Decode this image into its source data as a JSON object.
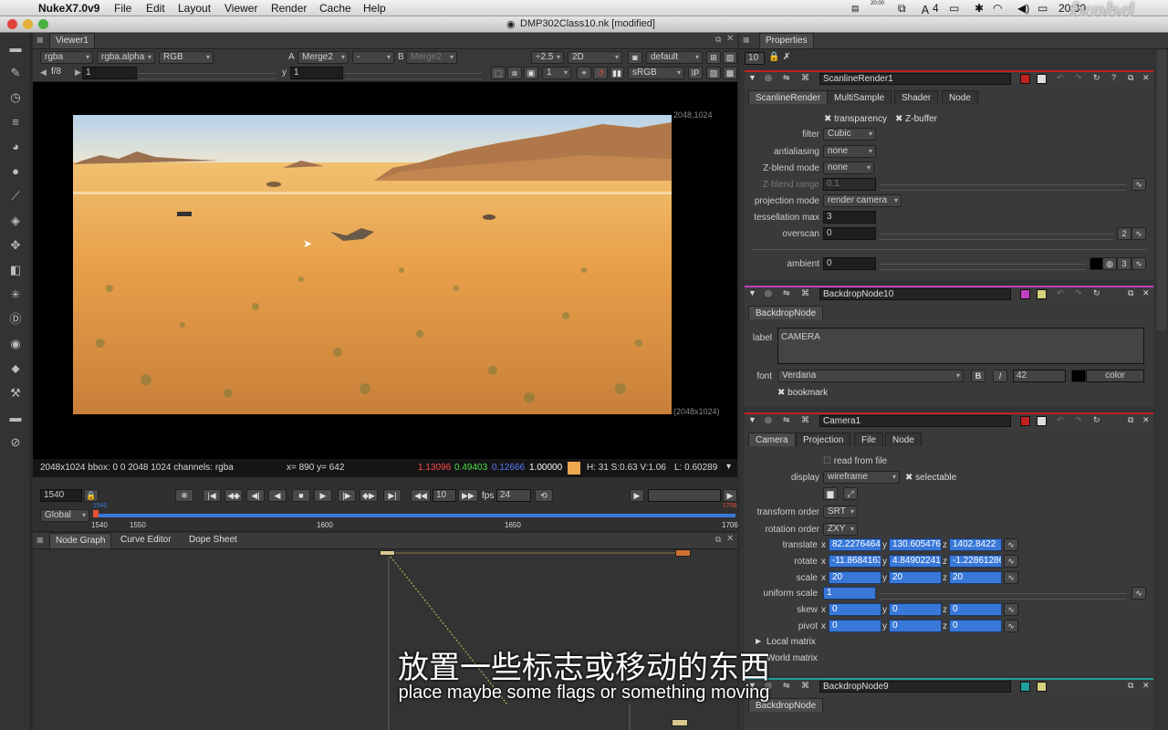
{
  "menubar": {
    "app": "NukeX7.0v9",
    "items": [
      "File",
      "Edit",
      "Layout",
      "Viewer",
      "Render",
      "Cache",
      "Help"
    ],
    "status": {
      "clock": "20:30",
      "badge": "4",
      "mini_time": "20:00"
    },
    "watermark": "fxphd"
  },
  "window": {
    "title": "DMP302Class10.nk [modified]"
  },
  "toolbar": {
    "icons": [
      "viewer-icon",
      "paint-icon",
      "time-icon",
      "channel-icon",
      "color-icon",
      "filter-icon",
      "keyer-icon",
      "merge-icon",
      "transform-icon",
      "3d-icon",
      "particles-icon",
      "deep-icon",
      "views-icon",
      "metadata-icon",
      "toolsets-icon",
      "other-icon",
      "furnace-icon"
    ]
  },
  "viewer": {
    "tab": "Viewer1",
    "row1": {
      "channels": "rgba",
      "alpha": "rgba.alpha",
      "display": "RGB",
      "a_label": "A",
      "a_input": "Merge2",
      "mid": "-",
      "b_label": "B",
      "b_input": "Merge2",
      "gain": "÷2.5",
      "mode": "2D",
      "lut": "default"
    },
    "row2": {
      "fstop": "f/8",
      "frame": "1",
      "y_label": "y",
      "y_value": "1",
      "proxy": "1",
      "colorspace": "sRGB",
      "ip": "IP"
    },
    "corner_tr": "2048,1024",
    "corner_br": "(2048x1024)",
    "info": {
      "format": "2048x1024 bbox: 0 0 2048 1024 channels: rgba",
      "coords": "x= 890 y= 642",
      "r": "1.13096",
      "g": "0.49403",
      "b": "0.12666",
      "a": "1.00000",
      "hsv": "H: 31 S:0.63 V:1.06",
      "lum": "L: 0.60289",
      "swatch": "#f0a850"
    }
  },
  "timeline": {
    "frame": "1540",
    "step": "10",
    "fps_label": "fps",
    "fps": "24",
    "range_mode": "Global",
    "start": "1540",
    "end": "1706",
    "ticks": [
      "1540",
      "1550",
      "1600",
      "1650",
      "1706"
    ],
    "marker_left": "1540",
    "marker_right": "1706"
  },
  "nodegraph": {
    "tabs": [
      "Node Graph",
      "Curve Editor",
      "Dope Sheet"
    ]
  },
  "properties": {
    "title": "Properties",
    "max_panels": "10",
    "scanline": {
      "name": "ScanlineRender1",
      "tabs": [
        "ScanlineRender",
        "MultiSample",
        "Shader",
        "Node"
      ],
      "transparency": "transparency",
      "zbuffer": "Z-buffer",
      "fields": [
        {
          "label": "filter",
          "value": "Cubic"
        },
        {
          "label": "antialiasing",
          "value": "none"
        },
        {
          "label": "Z-blend mode",
          "value": "none"
        },
        {
          "label": "Z-blend range",
          "value": "0.1"
        },
        {
          "label": "projection mode",
          "value": "render camera"
        },
        {
          "label": "tessellation max",
          "value": "3"
        },
        {
          "label": "overscan",
          "value": "0"
        },
        {
          "label": "ambient",
          "value": "0"
        }
      ],
      "overscan_count": "2",
      "ambient_count": "3"
    },
    "backdrop10": {
      "name": "BackdropNode10",
      "tab": "BackdropNode",
      "label_label": "label",
      "label_value": "CAMERA",
      "font_label": "font",
      "font_value": "Verdana",
      "font_size": "42",
      "bold": "B",
      "italic": "I",
      "color": "color",
      "bookmark": "bookmark"
    },
    "camera": {
      "name": "Camera1",
      "tabs": [
        "Camera",
        "Projection",
        "File",
        "Node"
      ],
      "read_from_file": "read from file",
      "display_label": "display",
      "display_value": "wireframe",
      "selectable": "selectable",
      "transform_order_label": "transform order",
      "transform_order": "SRT",
      "rotation_order_label": "rotation order",
      "rotation_order": "ZXY",
      "translate": {
        "label": "translate",
        "x": "82.2276464",
        "y": "130.605476",
        "z": "1402.8422"
      },
      "rotate": {
        "label": "rotate",
        "x": "-11.8684163",
        "y": "4.84902241",
        "z": "-1.22861286"
      },
      "scale": {
        "label": "scale",
        "x": "20",
        "y": "20",
        "z": "20"
      },
      "uniform_scale": {
        "label": "uniform scale",
        "value": "1"
      },
      "skew": {
        "label": "skew",
        "x": "0",
        "y": "0",
        "z": "0"
      },
      "pivot": {
        "label": "pivot",
        "x": "0",
        "y": "0",
        "z": "0"
      },
      "local_matrix": "Local matrix",
      "world_matrix": "World matrix"
    },
    "backdrop9": {
      "name": "BackdropNode9",
      "tab": "BackdropNode"
    }
  },
  "subtitle": {
    "cn": "放置一些标志或移动的东西",
    "en": "place maybe some flags or something moving"
  }
}
